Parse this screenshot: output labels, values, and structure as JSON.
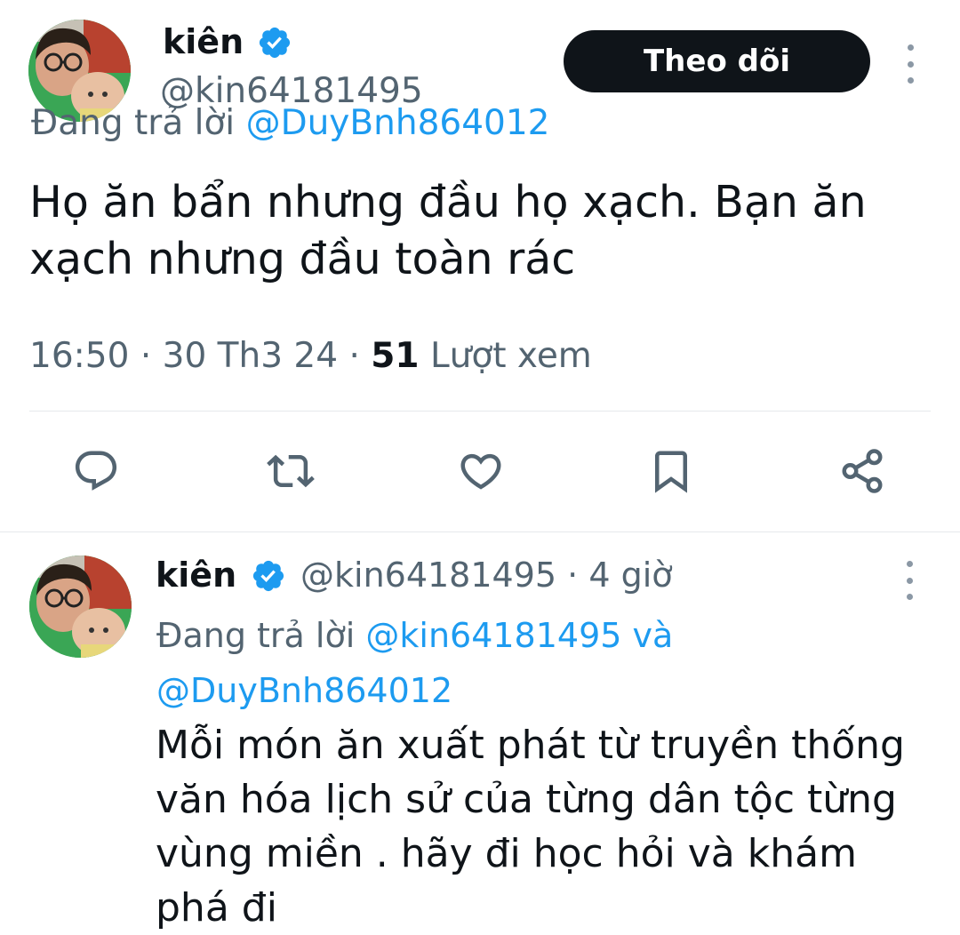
{
  "main_tweet": {
    "display_name": "kiên",
    "handle": "@kin64181495",
    "follow_label": "Theo dõi",
    "reply_prefix": "Đang trả lời",
    "reply_to": "@DuyBnh864012",
    "text": "Họ ăn bẩn nhưng đầu họ xạch. Bạn ăn xạch nhưng đầu toàn rác",
    "time": "16:50",
    "date": "30 Th3 24",
    "views_count": "51",
    "views_label": "Lượt xem",
    "actions": [
      "reply-icon",
      "retweet-icon",
      "like-icon",
      "bookmark-icon",
      "share-icon"
    ]
  },
  "reply_tweet": {
    "display_name": "kiên",
    "handle": "@kin64181495",
    "time_ago": "4 giờ",
    "reply_prefix": "Đang trả lời",
    "reply_to_1": "@kin64181495",
    "conjunction": "và",
    "reply_to_2": "@DuyBnh864012",
    "text": "Mỗi món ăn xuất phát từ truyền thống văn hóa lịch sử của từng dân tộc từng vùng miền . hãy đi học hỏi và khám phá đi"
  },
  "colors": {
    "accent": "#1d9bf0",
    "text": "#0f1419",
    "secondary": "#536471",
    "button_bg": "#0f1419",
    "divider": "#e6e9ec"
  }
}
